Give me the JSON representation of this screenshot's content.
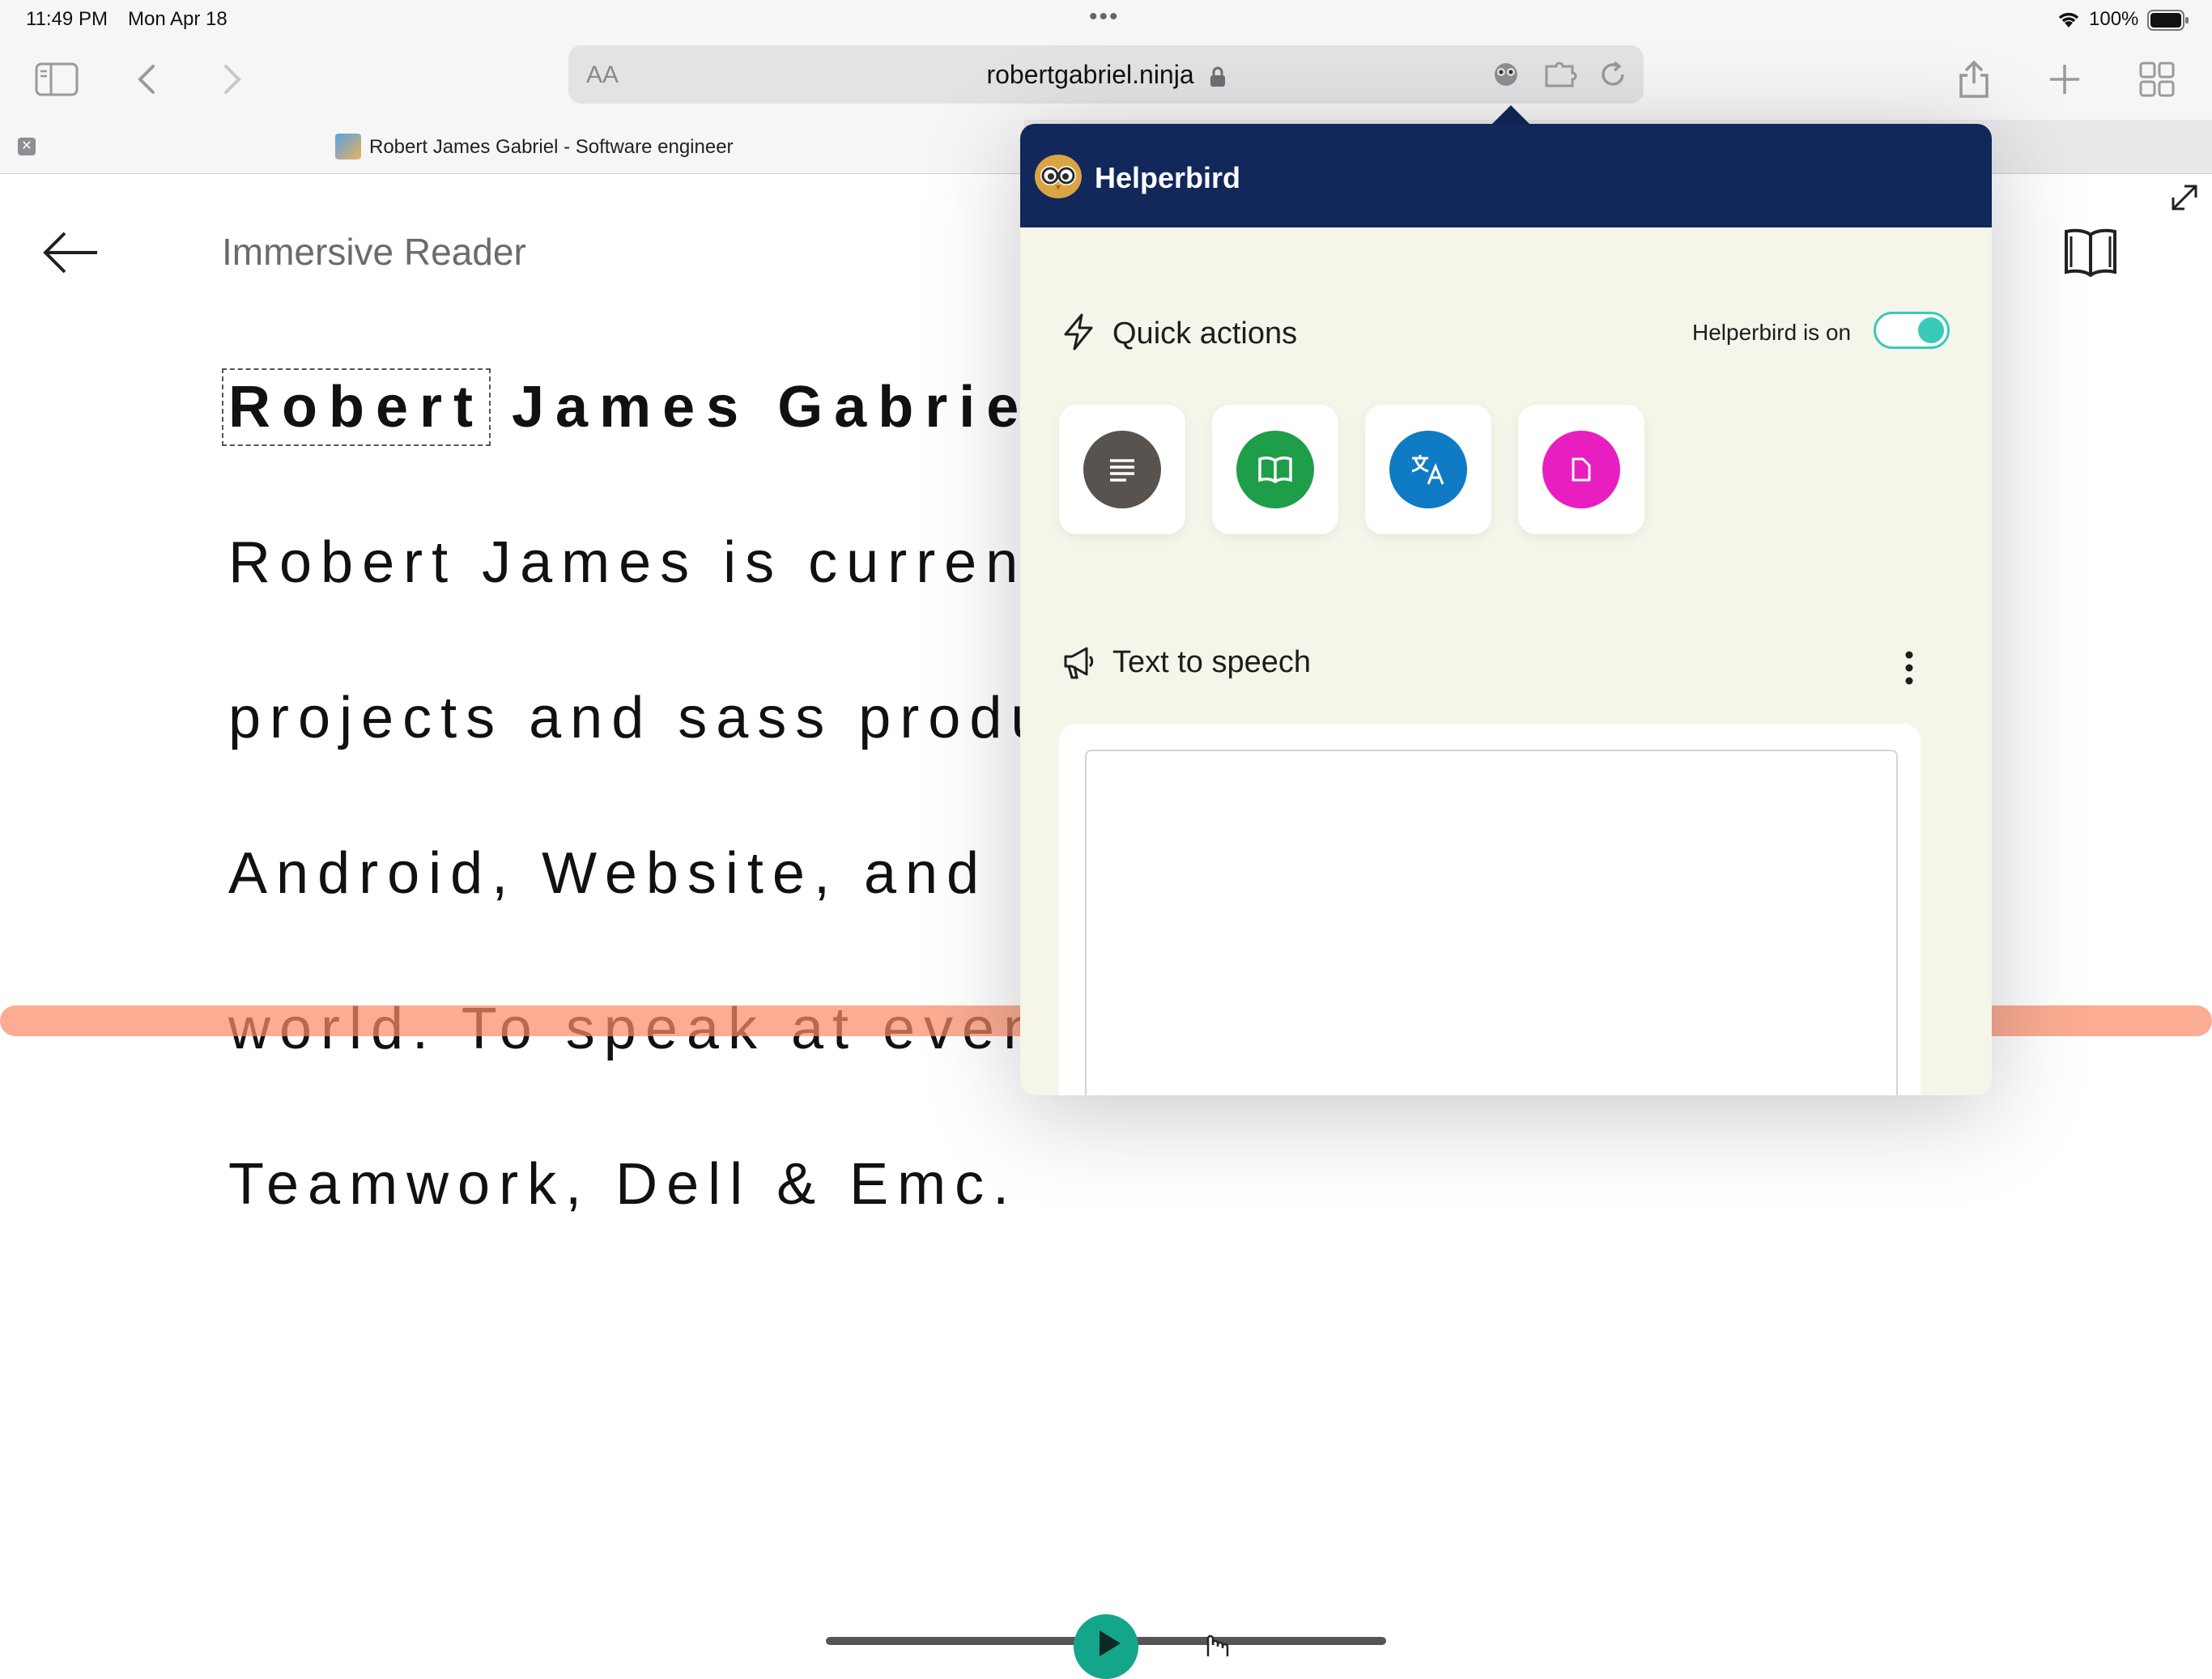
{
  "status_bar": {
    "time": "11:49 PM",
    "date": "Mon Apr 18",
    "battery_percent": "100%"
  },
  "browser": {
    "url_host": "robertgabriel.ninja",
    "text_size_label": "AA",
    "tab": {
      "title": "Robert James Gabriel - Software engineer"
    }
  },
  "reader": {
    "title": "Immersive Reader",
    "lines": [
      {
        "text": "Robert James Gabriel",
        "focus_word": "Robert",
        "rest": " James Gabriel"
      },
      {
        "text": "Robert James is currently"
      },
      {
        "text": "projects and sass products"
      },
      {
        "text": "Android, Website, and"
      },
      {
        "text": "world. To speak at events"
      },
      {
        "text": "Teamwork, Dell & Emc."
      }
    ]
  },
  "helperbird": {
    "title": "Helperbird",
    "quick_actions": {
      "label": "Quick actions",
      "status_label": "Helperbird is on",
      "enabled": true,
      "items": [
        {
          "icon": "text-lines-icon",
          "color": "#58534f"
        },
        {
          "icon": "book-icon",
          "color": "#1f9e4a"
        },
        {
          "icon": "translate-icon",
          "color": "#0e7bc4"
        },
        {
          "icon": "document-icon",
          "color": "#e81ec0"
        }
      ]
    },
    "tts": {
      "label": "Text to speech",
      "text": ""
    }
  },
  "colors": {
    "header": "#12275a",
    "panel_bg": "#f6f5e9",
    "toggle": "#3ac9b9",
    "line_focus": "#fa8c69",
    "play": "#14a68b"
  }
}
